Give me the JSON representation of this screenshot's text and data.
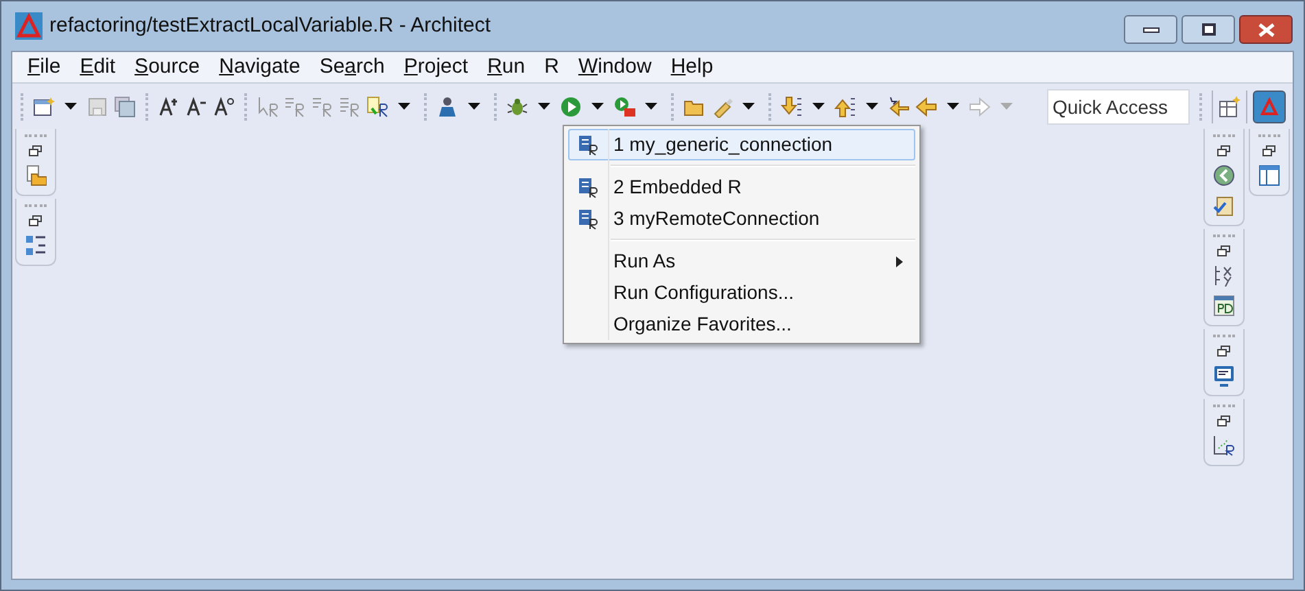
{
  "window": {
    "title": "refactoring/testExtractLocalVariable.R - Architect"
  },
  "menu_bar": [
    {
      "parts": [
        {
          "text": "F",
          "underlined": true
        },
        {
          "text": "ile",
          "underlined": false
        }
      ]
    },
    {
      "parts": [
        {
          "text": "E",
          "underlined": true
        },
        {
          "text": "dit",
          "underlined": false
        }
      ]
    },
    {
      "parts": [
        {
          "text": "S",
          "underlined": true
        },
        {
          "text": "ource",
          "underlined": false
        }
      ]
    },
    {
      "parts": [
        {
          "text": "N",
          "underlined": true
        },
        {
          "text": "avigate",
          "underlined": false
        }
      ]
    },
    {
      "parts": [
        {
          "text": "Se",
          "underlined": false
        },
        {
          "text": "a",
          "underlined": true
        },
        {
          "text": "rch",
          "underlined": false
        }
      ]
    },
    {
      "parts": [
        {
          "text": "P",
          "underlined": true
        },
        {
          "text": "roject",
          "underlined": false
        }
      ]
    },
    {
      "parts": [
        {
          "text": "R",
          "underlined": true
        },
        {
          "text": "un",
          "underlined": false
        }
      ]
    },
    {
      "parts": [
        {
          "text": "R",
          "underlined": false
        }
      ]
    },
    {
      "parts": [
        {
          "text": "W",
          "underlined": true
        },
        {
          "text": "indow",
          "underlined": false
        }
      ]
    },
    {
      "parts": [
        {
          "text": "H",
          "underlined": true
        },
        {
          "text": "elp",
          "underlined": false
        }
      ]
    }
  ],
  "quick_access": {
    "placeholder": "Quick Access"
  },
  "run_menu": {
    "items": [
      {
        "kind": "launch",
        "label": "1 my_generic_connection",
        "selected": true
      },
      {
        "kind": "separator"
      },
      {
        "kind": "launch",
        "label": "2 Embedded R",
        "selected": false
      },
      {
        "kind": "launch",
        "label": "3 myRemoteConnection",
        "selected": false
      },
      {
        "kind": "separator"
      },
      {
        "kind": "submenu",
        "label": "Run As",
        "selected": false
      },
      {
        "kind": "action",
        "label": "Run Configurations...",
        "selected": false
      },
      {
        "kind": "action",
        "label": "Organize Favorites...",
        "selected": false
      }
    ]
  }
}
